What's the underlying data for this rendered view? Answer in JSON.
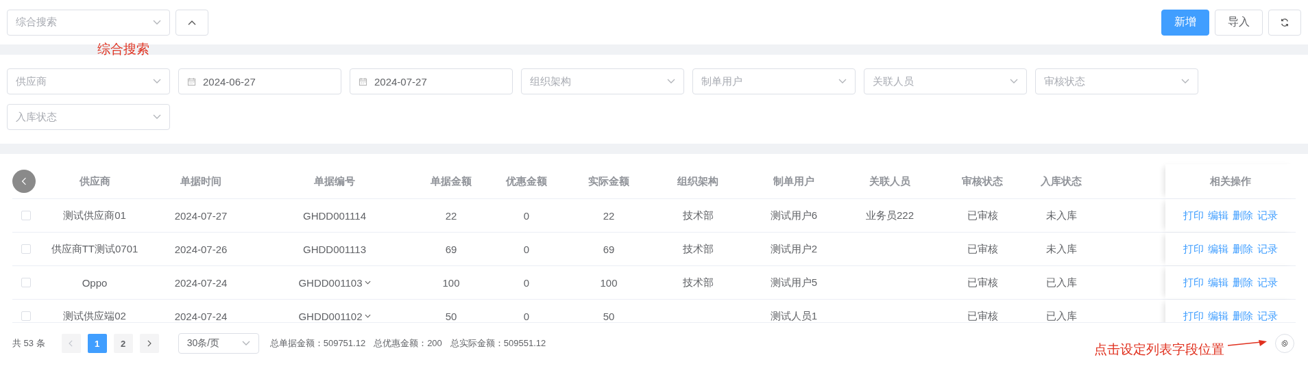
{
  "top": {
    "search_select": {
      "placeholder": "综合搜索"
    },
    "buttons": [
      {
        "kind": "primary",
        "label": "新增"
      },
      {
        "kind": "default",
        "label": "导入"
      },
      {
        "kind": "refresh"
      }
    ]
  },
  "annotations": [
    {
      "text": "综合搜索"
    },
    {
      "text": "点击设定列表字段位置"
    }
  ],
  "filters": [
    {
      "kind": "select",
      "placeholder": "供应商"
    },
    {
      "kind": "date",
      "value": "2024-06-27"
    },
    {
      "kind": "date",
      "value": "2024-07-27"
    },
    {
      "kind": "select",
      "placeholder": "组织架构"
    },
    {
      "kind": "select",
      "placeholder": "制单用户"
    },
    {
      "kind": "select",
      "placeholder": "关联人员"
    },
    {
      "kind": "select",
      "placeholder": "审核状态"
    },
    {
      "kind": "select",
      "placeholder": "入库状态"
    }
  ],
  "table": {
    "columns": [
      "供应商",
      "单据时间",
      "单据编号",
      "单据金额",
      "优惠金额",
      "实际金额",
      "组织架构",
      "制单用户",
      "关联人员",
      "审核状态",
      "入库状态"
    ],
    "actions_header": "相关操作",
    "rows": [
      {
        "checked": false,
        "expandable": false,
        "cells": [
          "测试供应商01",
          "2024-07-27",
          "GHDD001114",
          "22",
          "0",
          "22",
          "技术部",
          "测试用户6",
          "业务员222",
          "已审核",
          "未入库"
        ],
        "actions": [
          "打印",
          "编辑",
          "删除",
          "记录"
        ]
      },
      {
        "checked": false,
        "expandable": false,
        "cells": [
          "供应商TT测试0701",
          "2024-07-26",
          "GHDD001113",
          "69",
          "0",
          "69",
          "技术部",
          "测试用户2",
          "",
          "已审核",
          "未入库"
        ],
        "actions": [
          "打印",
          "编辑",
          "删除",
          "记录"
        ]
      },
      {
        "checked": false,
        "expandable": true,
        "cells": [
          "Oppo",
          "2024-07-24",
          "GHDD001103",
          "100",
          "0",
          "100",
          "技术部",
          "测试用户5",
          "",
          "已审核",
          "已入库"
        ],
        "actions": [
          "打印",
          "编辑",
          "删除",
          "记录"
        ]
      },
      {
        "checked": false,
        "expandable": true,
        "cells": [
          "测试供应端02",
          "2024-07-24",
          "GHDD001102",
          "50",
          "0",
          "50",
          "",
          "测试人员1",
          "",
          "已审核",
          "已入库"
        ],
        "actions": [
          "打印",
          "编辑",
          "删除",
          "记录"
        ]
      }
    ]
  },
  "footer": {
    "total": "共 53 条",
    "pages": [
      {
        "label": "1",
        "selected": true
      },
      {
        "label": "2",
        "selected": false
      }
    ],
    "page_size": "30条/页",
    "sums": [
      "总单据金额：509751.12",
      "总优惠金额：200",
      "总实际金额：509551.12"
    ]
  }
}
